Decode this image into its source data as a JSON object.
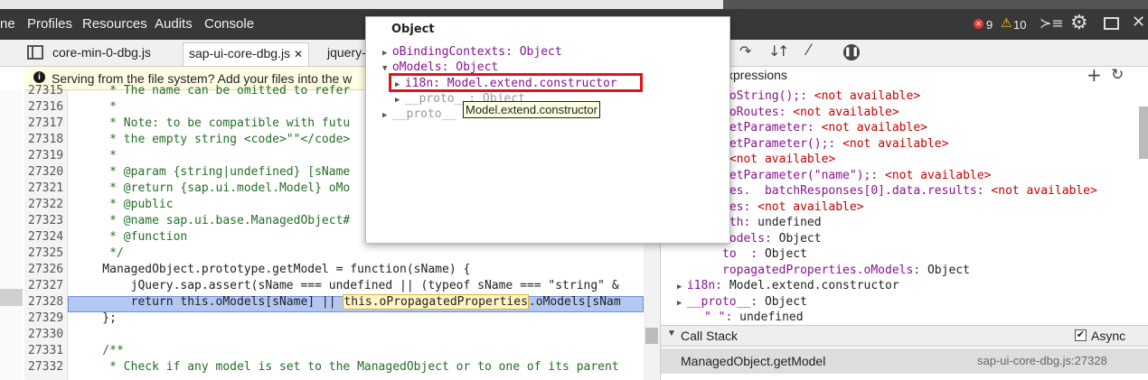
{
  "menu": [
    "ne",
    "Profiles",
    "Resources",
    "Audits",
    "Console"
  ],
  "status": {
    "errors": "9",
    "warnings": "10"
  },
  "file_tabs": [
    "core-min-0-dbg.js",
    "sap-ui-core-dbg.js",
    "jquery-"
  ],
  "info_bar": "Serving from the file system? Add your files into the w",
  "code_lines": [
    {
      "n": "27315",
      "t": "     * The name can be omitted to refer",
      "c": "comment"
    },
    {
      "n": "27316",
      "t": "     *",
      "c": "comment"
    },
    {
      "n": "27317",
      "t": "     * Note: to be compatible with futu",
      "c": "comment"
    },
    {
      "n": "27318",
      "t": "     * the empty string <code>\"\"</code>",
      "c": "comment"
    },
    {
      "n": "27319",
      "t": "     *",
      "c": "comment"
    },
    {
      "n": "27320",
      "t": "     * @param {string|undefined} [sName",
      "c": "comment"
    },
    {
      "n": "27321",
      "t": "     * @return {sap.ui.model.Model} oMo",
      "c": "comment"
    },
    {
      "n": "27322",
      "t": "     * @public",
      "c": "comment"
    },
    {
      "n": "27323",
      "t": "     * @name sap.ui.base.ManagedObject#",
      "c": "comment"
    },
    {
      "n": "27324",
      "t": "     * @function",
      "c": "comment"
    },
    {
      "n": "27325",
      "t": "     */",
      "c": "comment"
    },
    {
      "n": "27326",
      "t": "    ManagedObject.prototype.getModel = function(sName) {",
      "c": "plain"
    },
    {
      "n": "27327",
      "t": "        jQuery.sap.assert(sName === undefined || (typeof sName === \"string\" &",
      "c": "plain"
    },
    {
      "n": "27328",
      "t": "        return this.oModels[sName] || this.oPropagatedProperties.oModels[sNam",
      "c": "plain"
    },
    {
      "n": "27329",
      "t": "    };",
      "c": "plain"
    },
    {
      "n": "27330",
      "t": "",
      "c": "plain"
    },
    {
      "n": "27331",
      "t": "    /**",
      "c": "comment"
    },
    {
      "n": "27332",
      "t": "     * Check if any model is set to the ManagedObject or to one of its parent",
      "c": "comment"
    }
  ],
  "popup": {
    "title": "Object",
    "lines": [
      {
        "t": "oBindingContexts: Object"
      },
      {
        "t": "oModels: Object"
      },
      {
        "t": "i18n: Model.extend.constructor"
      },
      {
        "t": "__proto__: Object"
      },
      {
        "t": "__proto__"
      }
    ],
    "tooltip": "Model.extend.constructor"
  },
  "watch": {
    "header": "xpressions",
    "lines": [
      {
        "p": "toString();: ",
        "v": "<not available>"
      },
      {
        "p": "_oRoutes: ",
        "v": "<not available>"
      },
      {
        "p": "getParameter: ",
        "v": "<not available>"
      },
      {
        "p": "getParameter();: ",
        "v": "<not available>"
      },
      {
        "p": " ",
        "v": "<not available>"
      },
      {
        "p": "getParameter(\"name\");: ",
        "v": "<not available>"
      },
      {
        "p": "ses.  batchResponses[0].data.results: ",
        "v": "<not available>"
      },
      {
        "p": "ses: ",
        "v": "<not available>"
      },
      {
        "p": "ath: ",
        "v": "undefined"
      },
      {
        "p": "Models: ",
        "v": "Object"
      },
      {
        "p": "to  : ",
        "v": "Object"
      },
      {
        "p": "ropagatedProperties.oModels: ",
        "v": "Object"
      },
      {
        "p": "i18n: ",
        "v": "Model.extend.constructor"
      },
      {
        "p": "__proto__: ",
        "v": "Object"
      },
      {
        "p": "\" \": ",
        "v": "undefined"
      }
    ]
  },
  "call_stack": {
    "title": "Call Stack",
    "async": "Async",
    "frame": "ManagedObject.getModel",
    "location": "sap-ui-core-dbg.js:27328"
  }
}
